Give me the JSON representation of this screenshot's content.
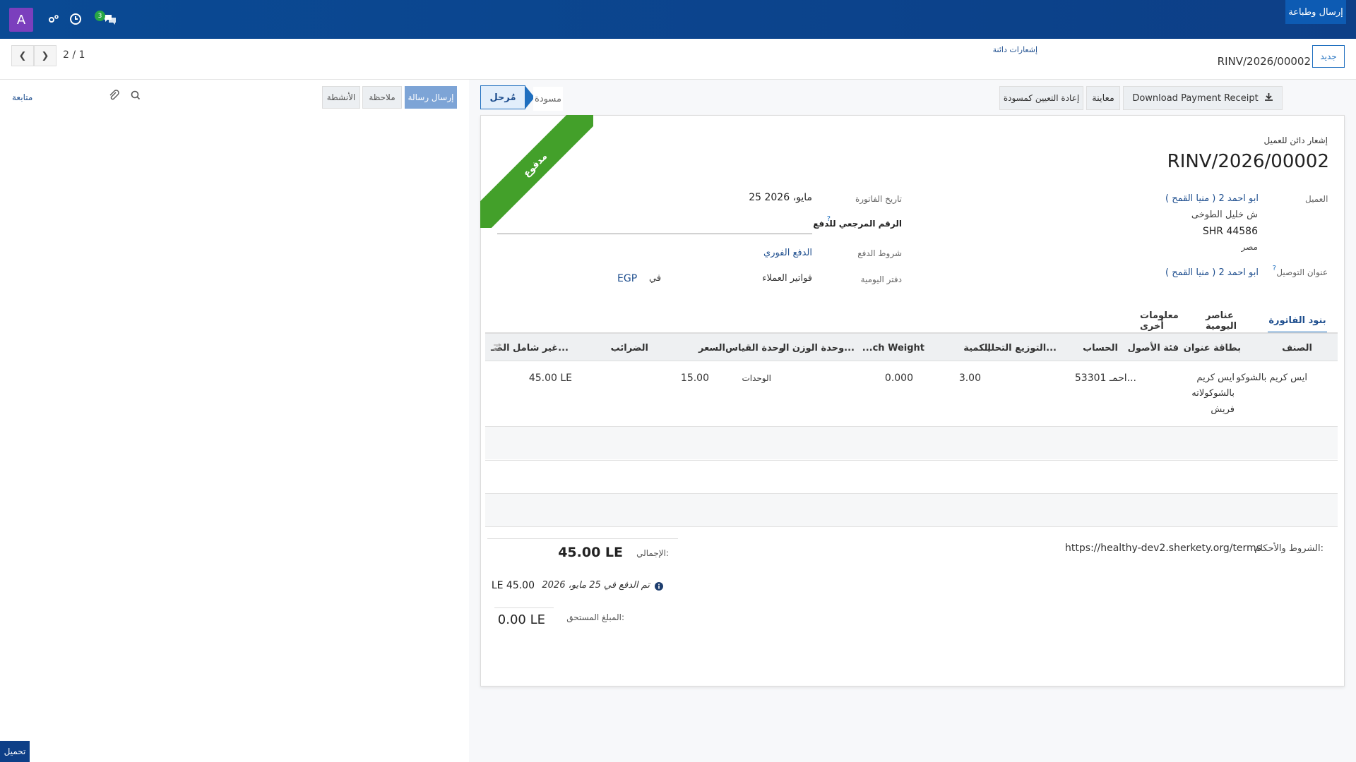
{
  "navbar": {
    "avatar_letter": "A",
    "messages_count": "3"
  },
  "control_panel": {
    "breadcrumb_parent": "إشعارات دائنة",
    "breadcrumb_current": "RINV/2026/00002",
    "new_button": "جديد",
    "pager": "2 / 1"
  },
  "status_bar": {
    "buttons": {
      "send_print": "إرسال وطباعة",
      "download_receipt": "Download Payment Receipt",
      "preview": "معاينة",
      "reset_draft": "إعادة التعيين كمسودة"
    },
    "states": {
      "posted": "مُرحل",
      "draft": "مسودة"
    }
  },
  "chatter": {
    "send_message": "إرسال رسالة",
    "log_note": "ملاحظة",
    "activities": "الأنشطة",
    "follow": "متابعة"
  },
  "form": {
    "ribbon": "مدفوع",
    "doc_type": "إشعار دائن للعميل",
    "doc_number": "RINV/2026/00002",
    "customer_label": "العميل",
    "customer_name": "ابو احمد 2 ( منيا القمح )",
    "customer_street": "ش خليل الطوخى",
    "customer_code": "SHR 44586",
    "customer_country": "مصر",
    "delivery_label": "عنوان التوصيل",
    "delivery_value": "ابو احمد 2 ( منيا القمح )",
    "invoice_date_label": "تاريخ الفاتورة",
    "invoice_date_value": "25 مايو، 2026",
    "payment_ref_label": "الرقم المرجعي للدفع",
    "payment_terms_label": "شروط الدفع",
    "payment_terms_value": "الدفع الفوري",
    "journal_label": "دفتر اليومية",
    "journal_value": "فواتير العملاء",
    "in_label": "في",
    "currency": "EGP"
  },
  "tabs": {
    "invoice_lines": "بنود الفاتورة",
    "journal_items": "عناصر اليومية",
    "other_info": "معلومات أخرى"
  },
  "table": {
    "headers": {
      "product": "الصنف",
      "label": "بطاقة عنوان",
      "asset_category": "فئة الأصول",
      "account": "الحساب",
      "analytic": "التوزيع التحليـ...",
      "quantity": "الكمية",
      "catch_weight": "...ch Weight",
      "weight_uom": "وحدة الوزن الـ...",
      "uom": "وحدة القياس",
      "price": "السعر",
      "taxes": "الضرائب",
      "subtotal": "غير شامل الضـ..."
    },
    "row": {
      "product": "ايس كريم بالشوكو",
      "label_line1": "ايس كريم",
      "label_line2": "بالشوكولاته",
      "label_line3": "فريش",
      "account": "53301 احمـ...",
      "quantity": "3.00",
      "catch_weight": "0.000",
      "uom": "الوحدات",
      "price": "15.00",
      "subtotal": "45.00 LE"
    }
  },
  "totals": {
    "terms_label": "الشروط والأحكام:",
    "terms_url": "https://healthy-dev2.sherkety.org/terms",
    "total_label": "الإجمالي:",
    "total_value": "45.00 LE",
    "paid_text": "تم الدفع في 25 مايو، 2026",
    "paid_amount": "LE 45.00",
    "due_label": "المبلغ المستحق:",
    "due_value": "0.00 LE"
  },
  "footer": {
    "upload": "تحميل"
  }
}
